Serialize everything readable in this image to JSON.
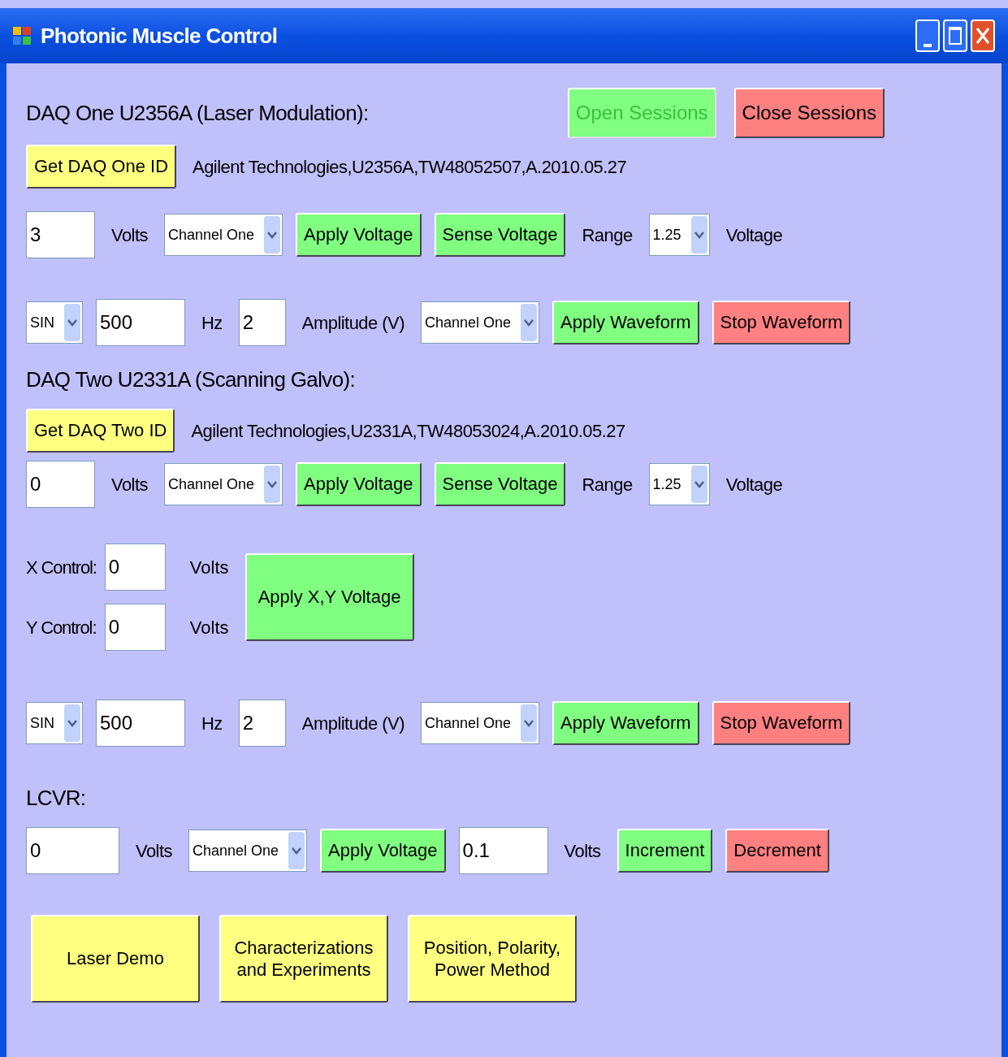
{
  "window": {
    "title": "Photonic Muscle Control"
  },
  "rows": [
    {
      "kind": "heading",
      "text": "DAQ One U2356A (Laser Modulation):",
      "buttons": [
        {
          "label": "Open Sessions",
          "color": "#80ff80",
          "disabled": true
        },
        {
          "label": "Close Sessions",
          "color": "#ff8080",
          "disabled": false
        }
      ]
    },
    {
      "kind": "controls",
      "items": [
        {
          "kind": "button",
          "label": "Get DAQ One ID",
          "color": "#ffff80",
          "disabled": false
        },
        {
          "kind": "label",
          "text": "Agilent Technologies,U2356A,TW48052507,A.2010.05.27"
        }
      ]
    },
    {
      "kind": "controls",
      "items": [
        {
          "kind": "field",
          "value": "3"
        },
        {
          "kind": "label",
          "text": "Volts"
        },
        {
          "kind": "select",
          "value": "Channel One"
        },
        {
          "kind": "button",
          "label": "Apply Voltage",
          "color": "#80ff80",
          "disabled": false
        },
        {
          "kind": "button",
          "label": "Sense Voltage",
          "color": "#80ff80",
          "disabled": false
        },
        {
          "kind": "label",
          "text": "Range"
        },
        {
          "kind": "select",
          "value": "1.25"
        },
        {
          "kind": "label",
          "text": "Voltage"
        }
      ]
    },
    {
      "kind": "controls",
      "items": [
        {
          "kind": "select",
          "value": "SIN"
        },
        {
          "kind": "field",
          "value": "500"
        },
        {
          "kind": "label",
          "text": "Hz"
        },
        {
          "kind": "field",
          "value": "2"
        },
        {
          "kind": "label",
          "text": "Amplitude (V)"
        },
        {
          "kind": "select",
          "value": "Channel One"
        },
        {
          "kind": "button",
          "label": "Apply Waveform",
          "color": "#80ff80",
          "disabled": false
        },
        {
          "kind": "button",
          "label": "Stop Waveform",
          "color": "#ff8080",
          "disabled": false
        }
      ]
    },
    {
      "kind": "heading",
      "text": "DAQ Two U2331A (Scanning Galvo):"
    },
    {
      "kind": "controls",
      "items": [
        {
          "kind": "button",
          "label": "Get DAQ Two ID",
          "color": "#ffff80",
          "disabled": false
        },
        {
          "kind": "label",
          "text": "Agilent Technologies,U2331A,TW48053024,A.2010.05.27"
        }
      ]
    },
    {
      "kind": "controls",
      "items": [
        {
          "kind": "field",
          "value": "0"
        },
        {
          "kind": "label",
          "text": "Volts"
        },
        {
          "kind": "select",
          "value": "Channel One"
        },
        {
          "kind": "button",
          "label": "Apply Voltage",
          "color": "#80ff80",
          "disabled": false
        },
        {
          "kind": "button",
          "label": "Sense Voltage",
          "color": "#80ff80",
          "disabled": false
        },
        {
          "kind": "label",
          "text": "Range"
        },
        {
          "kind": "select",
          "value": "1.25"
        },
        {
          "kind": "label",
          "text": "Voltage"
        }
      ]
    },
    {
      "kind": "xy",
      "lines": [
        {
          "label": "X Control:",
          "value": "0",
          "unit": "Volts"
        },
        {
          "label": "Y Control:",
          "value": "0",
          "unit": "Volts"
        }
      ],
      "button": {
        "label": "Apply X,Y Voltage",
        "color": "#80ff80",
        "disabled": false
      }
    },
    {
      "kind": "controls",
      "items": [
        {
          "kind": "select",
          "value": "SIN"
        },
        {
          "kind": "field",
          "value": "500"
        },
        {
          "kind": "label",
          "text": "Hz"
        },
        {
          "kind": "field",
          "value": "2"
        },
        {
          "kind": "label",
          "text": "Amplitude (V)"
        },
        {
          "kind": "select",
          "value": "Channel One"
        },
        {
          "kind": "button",
          "label": "Apply Waveform",
          "color": "#80ff80",
          "disabled": false
        },
        {
          "kind": "button",
          "label": "Stop Waveform",
          "color": "#ff8080",
          "disabled": false
        }
      ]
    },
    {
      "kind": "heading",
      "text": "LCVR:"
    },
    {
      "kind": "controls",
      "items": [
        {
          "kind": "field",
          "value": "0"
        },
        {
          "kind": "label",
          "text": "Volts"
        },
        {
          "kind": "select",
          "value": "Channel One"
        },
        {
          "kind": "button",
          "label": "Apply Voltage",
          "color": "#80ff80",
          "disabled": false
        },
        {
          "kind": "field",
          "value": "0.1"
        },
        {
          "kind": "label",
          "text": "Volts"
        },
        {
          "kind": "button",
          "label": "Increment",
          "color": "#80ff80",
          "disabled": false
        },
        {
          "kind": "button",
          "label": "Decrement",
          "color": "#ff8080",
          "disabled": false
        }
      ]
    },
    {
      "kind": "big_buttons",
      "buttons": [
        {
          "label": "Laser Demo",
          "color": "#ffff80",
          "disabled": false
        },
        {
          "label": "Characterizations and Experiments",
          "color": "#ffff80",
          "disabled": false
        },
        {
          "label": "Position, Polarity, Power Method",
          "color": "#ffff80",
          "disabled": false
        }
      ]
    }
  ]
}
